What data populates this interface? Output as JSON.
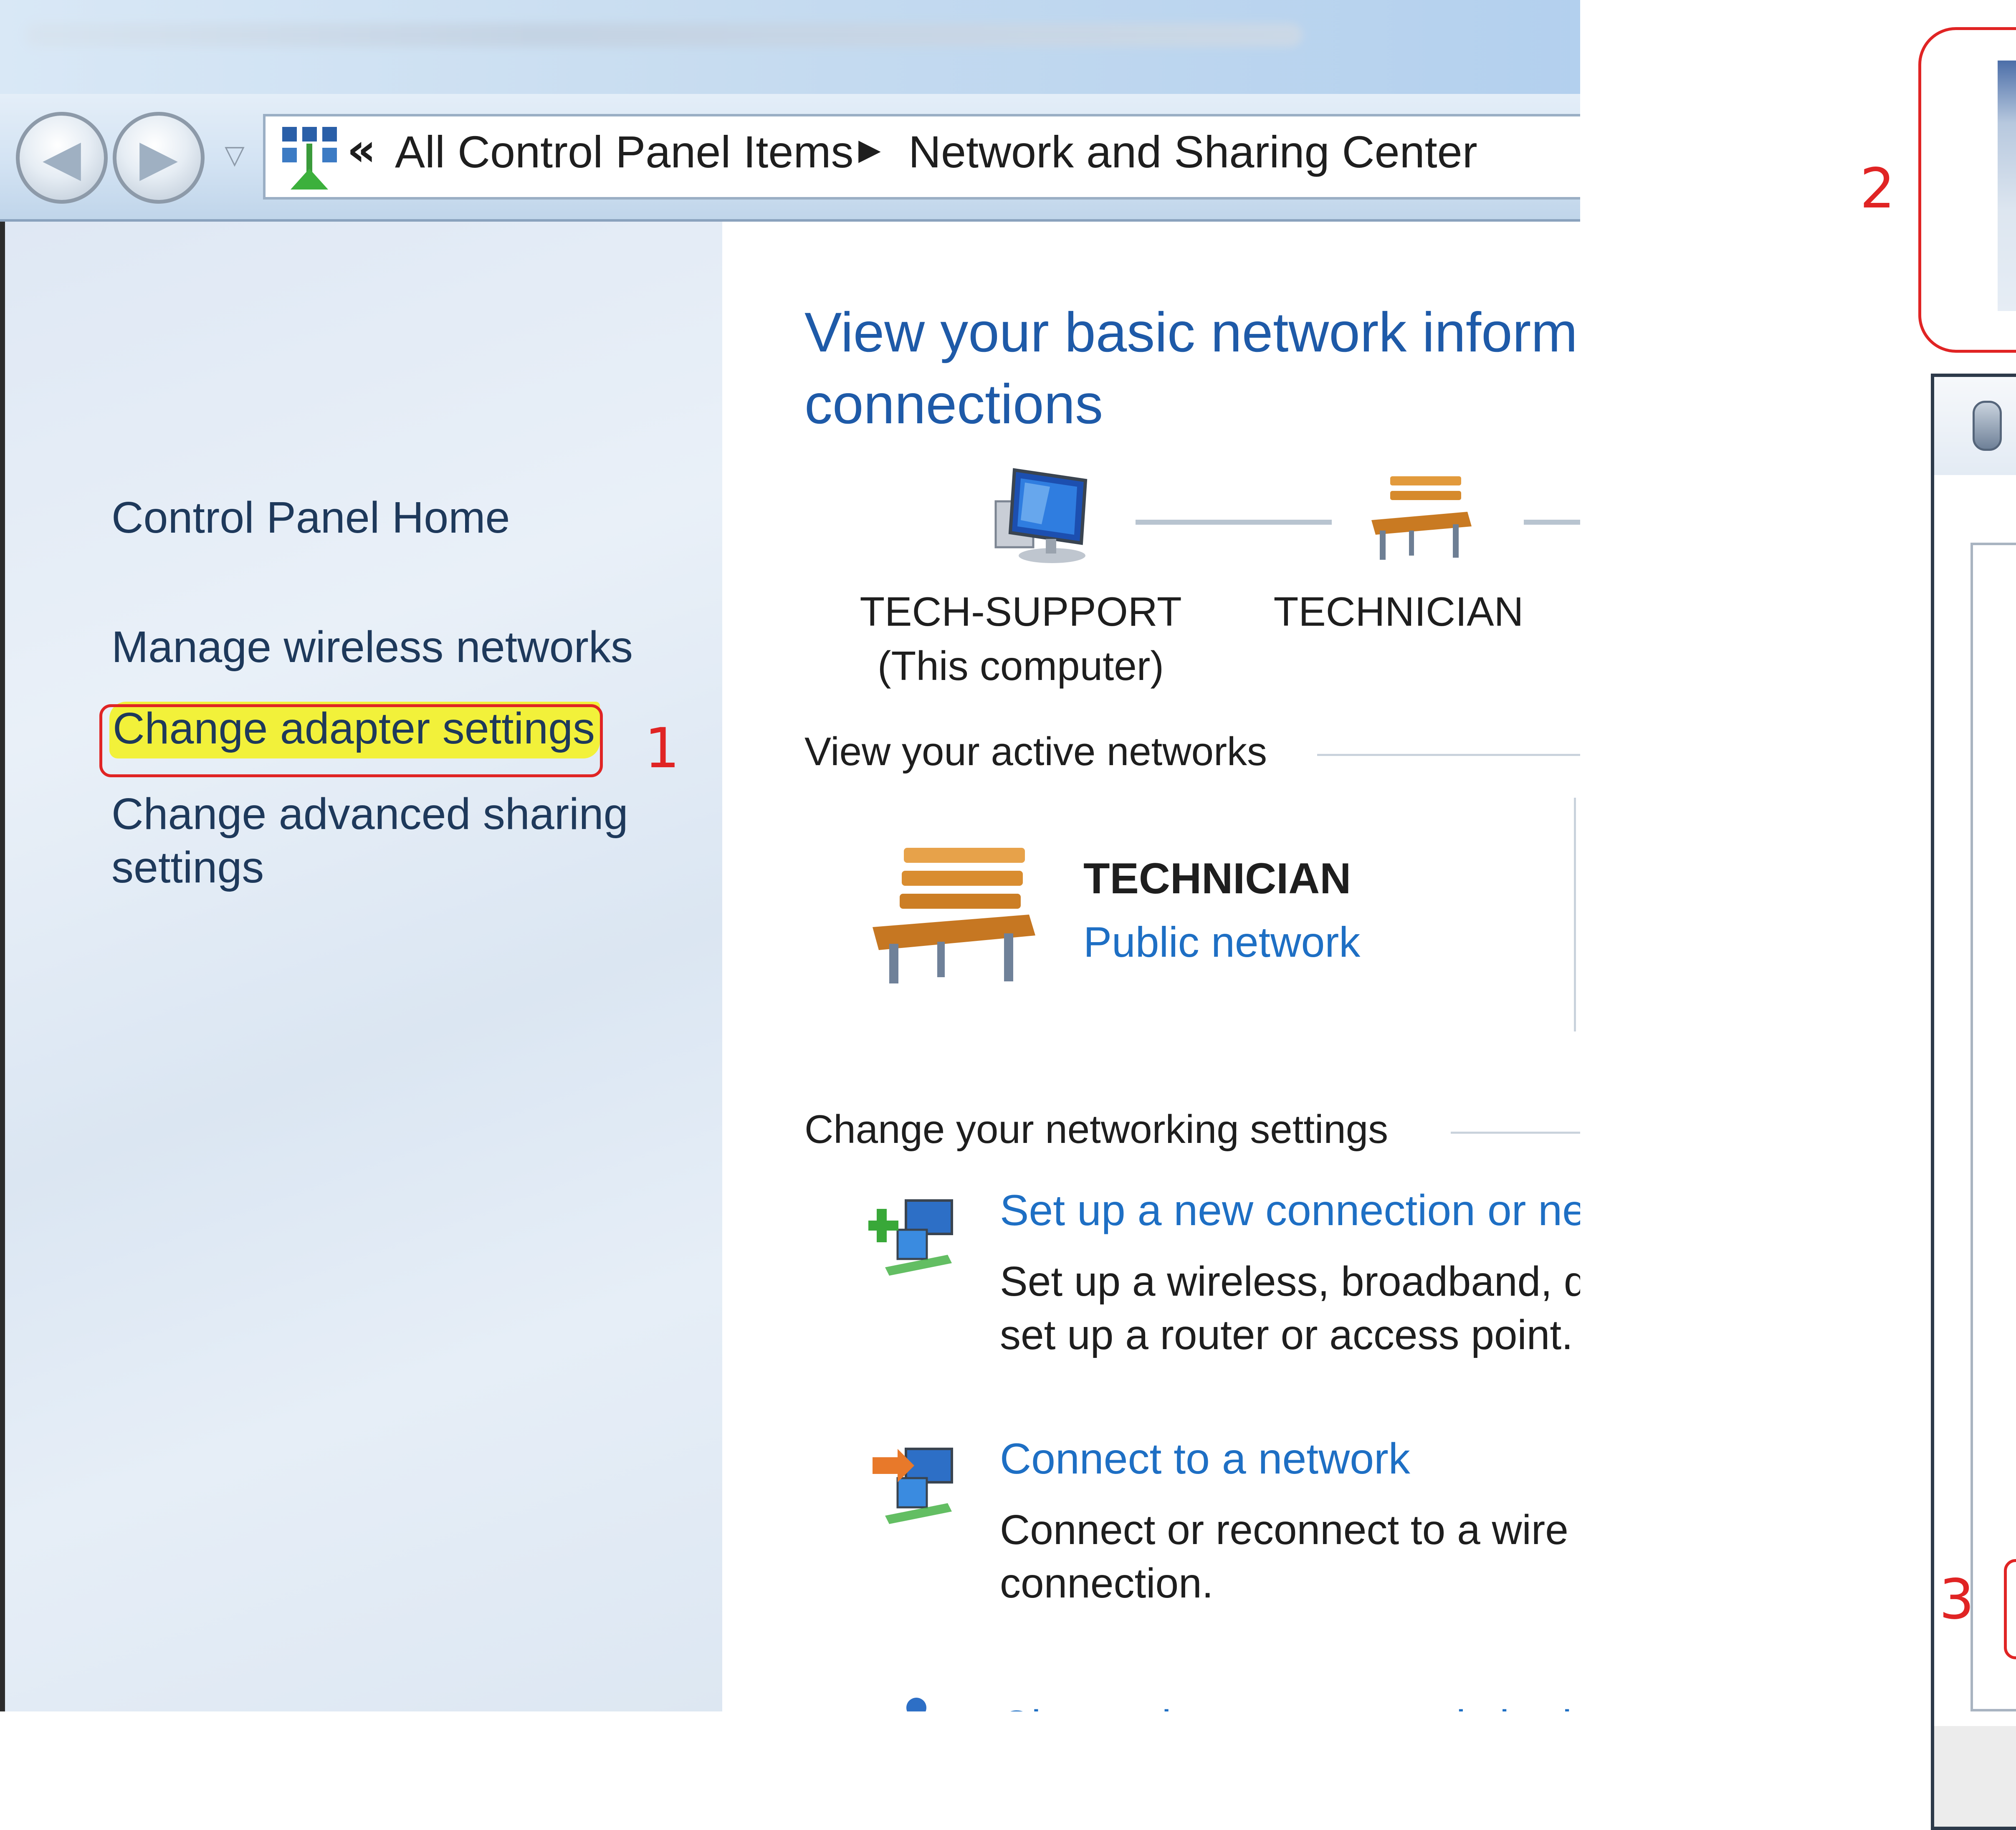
{
  "address_bar": {
    "chevron": "«",
    "crumbs": [
      "All Control Panel Items",
      "Network and Sharing Center"
    ],
    "separator_icon": "breadcrumb-arrow-icon"
  },
  "nav_icons": [
    "back-arrow-icon",
    "forward-arrow-icon",
    "recent-pages-dropdown-icon"
  ],
  "left_pane": {
    "items": [
      "Control Panel Home",
      "Manage wireless networks",
      "Change adapter settings",
      "Change advanced sharing settings"
    ]
  },
  "main": {
    "title": "View your basic network inform\nconnections",
    "network_map": {
      "computer_name": "TECH-SUPPORT",
      "computer_sub": "(This computer)",
      "network_name": "TECHNICIAN"
    },
    "active_networks": {
      "heading": "View your active networks",
      "network_name": "TECHNICIAN",
      "network_type": "Public network"
    },
    "settings": {
      "heading": "Change your networking settings",
      "tasks": [
        {
          "link": "Set up a new connection or net",
          "desc": "Set up a wireless, broadband, d\nset up a router or access point.",
          "icon": "new-connection-icon"
        },
        {
          "link": "Connect to a network",
          "desc": "Connect or reconnect to a wire\nconnection.",
          "icon": "connect-network-icon"
        },
        {
          "link": "Choose homegroup and sharin",
          "icon": "homegroup-icon"
        }
      ]
    }
  },
  "annotations": {
    "step_1": "1",
    "step_2": "2",
    "step_3": "3",
    "color": "#e02424",
    "highlight_color": "#f2f13a"
  },
  "colors": {
    "link": "#1e6fc4",
    "title": "#1e5aa8",
    "nav_text": "#1e395b"
  }
}
